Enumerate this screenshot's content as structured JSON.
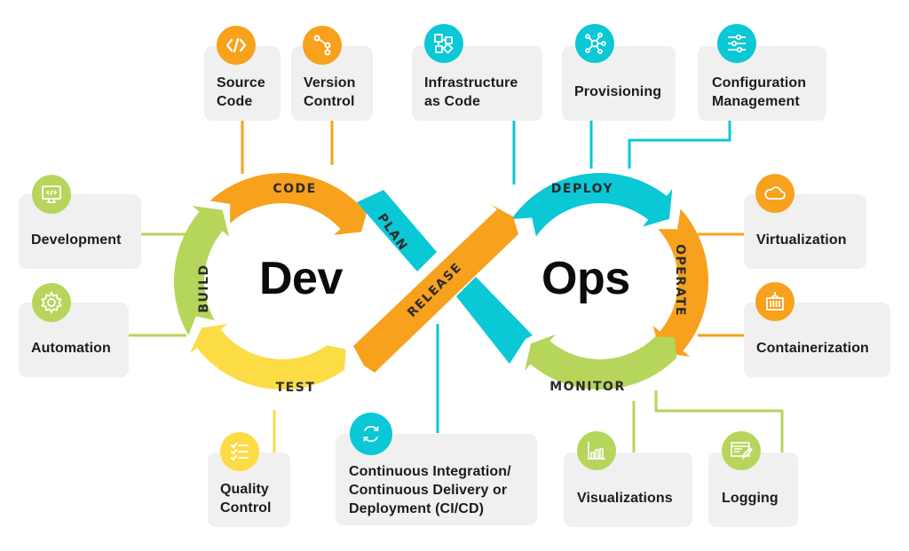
{
  "colors": {
    "orange": "#f7a11d",
    "cyan": "#0ac8d6",
    "green": "#b6d55b",
    "yellow": "#fbdc45",
    "card_bg": "#f0f0f0",
    "text": "#1c1c1c",
    "segment_text": "#2b2b2b"
  },
  "center": {
    "dev_label": "Dev",
    "ops_label": "Ops"
  },
  "loop_segments": [
    {
      "id": "code",
      "label": "CODE",
      "color": "orange"
    },
    {
      "id": "plan",
      "label": "PLAN",
      "color": "cyan"
    },
    {
      "id": "release",
      "label": "RELEASE",
      "color": "orange"
    },
    {
      "id": "deploy",
      "label": "DEPLOY",
      "color": "cyan"
    },
    {
      "id": "operate",
      "label": "OPERATE",
      "color": "orange"
    },
    {
      "id": "monitor",
      "label": "MONITOR",
      "color": "green"
    },
    {
      "id": "build",
      "label": "BUILD",
      "color": "green"
    },
    {
      "id": "test",
      "label": "TEST",
      "color": "yellow"
    }
  ],
  "cards": {
    "source_code": {
      "lines": [
        "Source",
        "Code"
      ],
      "icon": "code-brackets-icon",
      "color": "orange"
    },
    "version_control": {
      "lines": [
        "Version",
        "Control"
      ],
      "icon": "git-branch-icon",
      "color": "orange"
    },
    "infrastructure_as_code": {
      "lines": [
        "Infrastructure",
        "as Code"
      ],
      "icon": "infrastructure-blocks-icon",
      "color": "cyan"
    },
    "provisioning": {
      "lines": [
        "Provisioning"
      ],
      "icon": "network-hub-icon",
      "color": "cyan"
    },
    "configuration_management": {
      "lines": [
        "Configuration",
        "Management"
      ],
      "icon": "sliders-icon",
      "color": "cyan"
    },
    "development": {
      "lines": [
        "Development"
      ],
      "icon": "monitor-code-icon",
      "color": "green"
    },
    "automation": {
      "lines": [
        "Automation"
      ],
      "icon": "gear-icon",
      "color": "green"
    },
    "virtualization": {
      "lines": [
        "Virtualization"
      ],
      "icon": "cloud-icon",
      "color": "orange"
    },
    "containerization": {
      "lines": [
        "Containerization"
      ],
      "icon": "container-icon",
      "color": "orange"
    },
    "quality_control": {
      "lines": [
        "Quality",
        "Control"
      ],
      "icon": "checklist-icon",
      "color": "yellow"
    },
    "cicd": {
      "lines": [
        "Continuous Integration/",
        "Continuous Delivery or",
        "Deployment (CI/CD)"
      ],
      "icon": "refresh-cycle-icon",
      "color": "cyan"
    },
    "visualizations": {
      "lines": [
        "Visualizations"
      ],
      "icon": "bar-chart-icon",
      "color": "green"
    },
    "logging": {
      "lines": [
        "Logging"
      ],
      "icon": "log-edit-icon",
      "color": "green"
    }
  }
}
